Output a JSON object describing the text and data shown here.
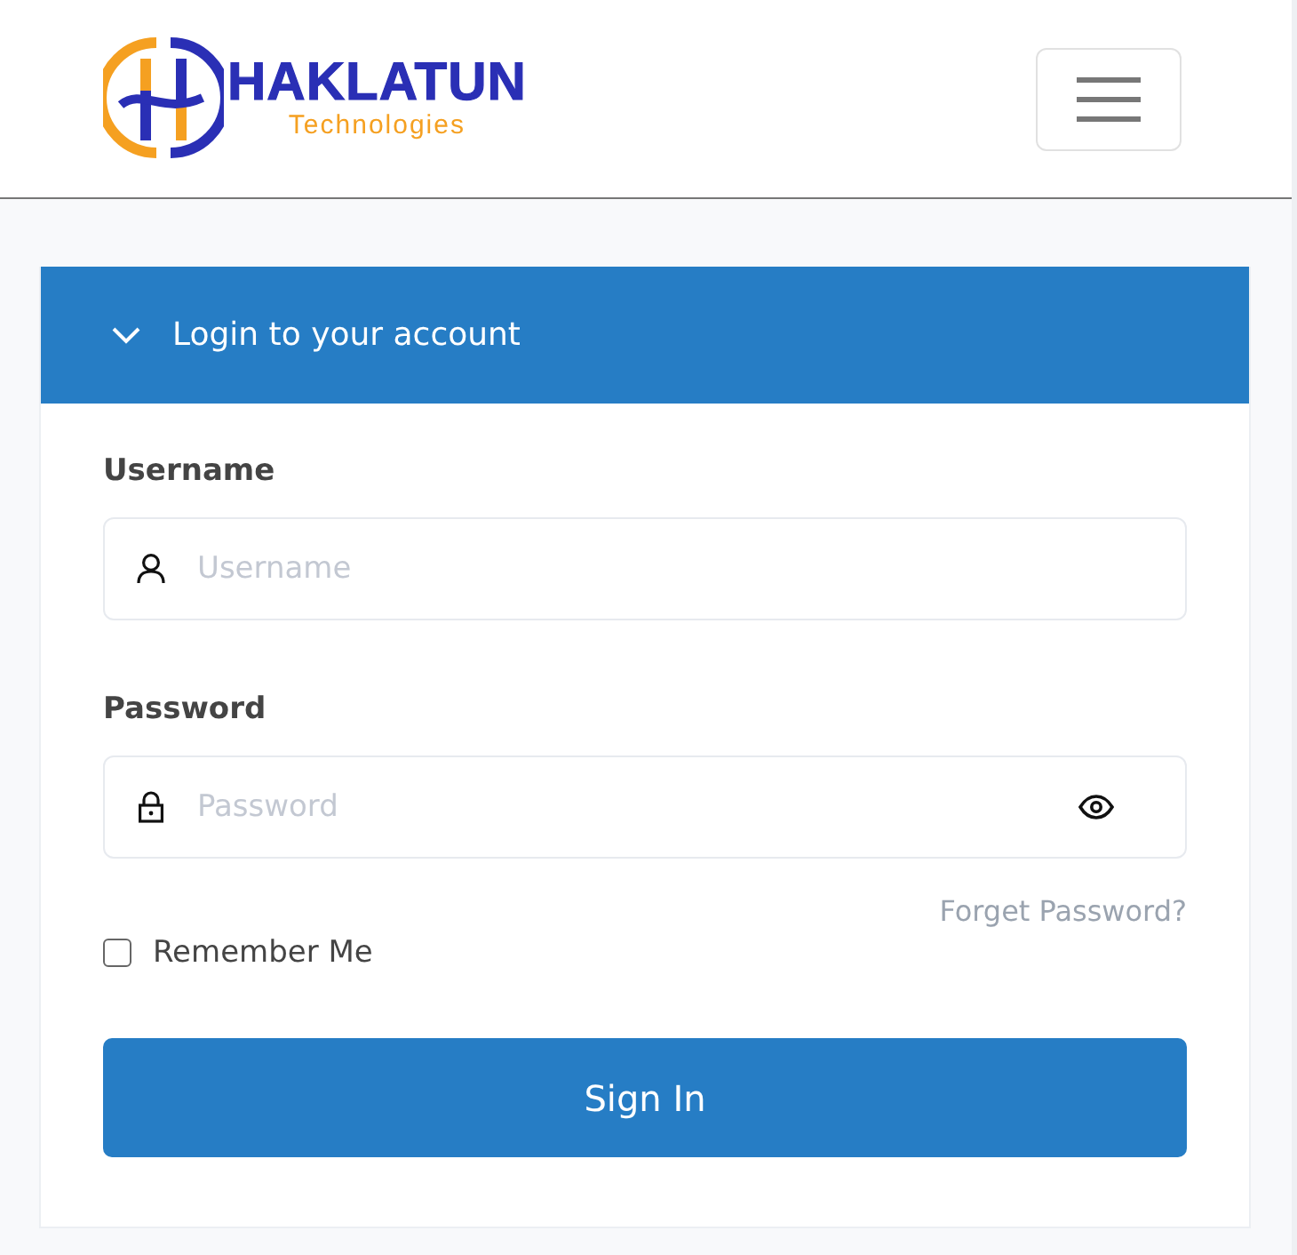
{
  "header": {
    "logo": {
      "title": "HAKLATUN",
      "subtitle": "Technologies"
    }
  },
  "login_panel": {
    "title": "Login to your account",
    "expanded": true,
    "fields": [
      {
        "kind": "text",
        "label": "Username",
        "placeholder": "Username"
      },
      {
        "kind": "password",
        "label": "Password",
        "placeholder": "Password"
      }
    ],
    "forgot_link": "Forget Password?",
    "remember": {
      "label": "Remember Me",
      "checked": false
    },
    "submit": "Sign In"
  }
}
